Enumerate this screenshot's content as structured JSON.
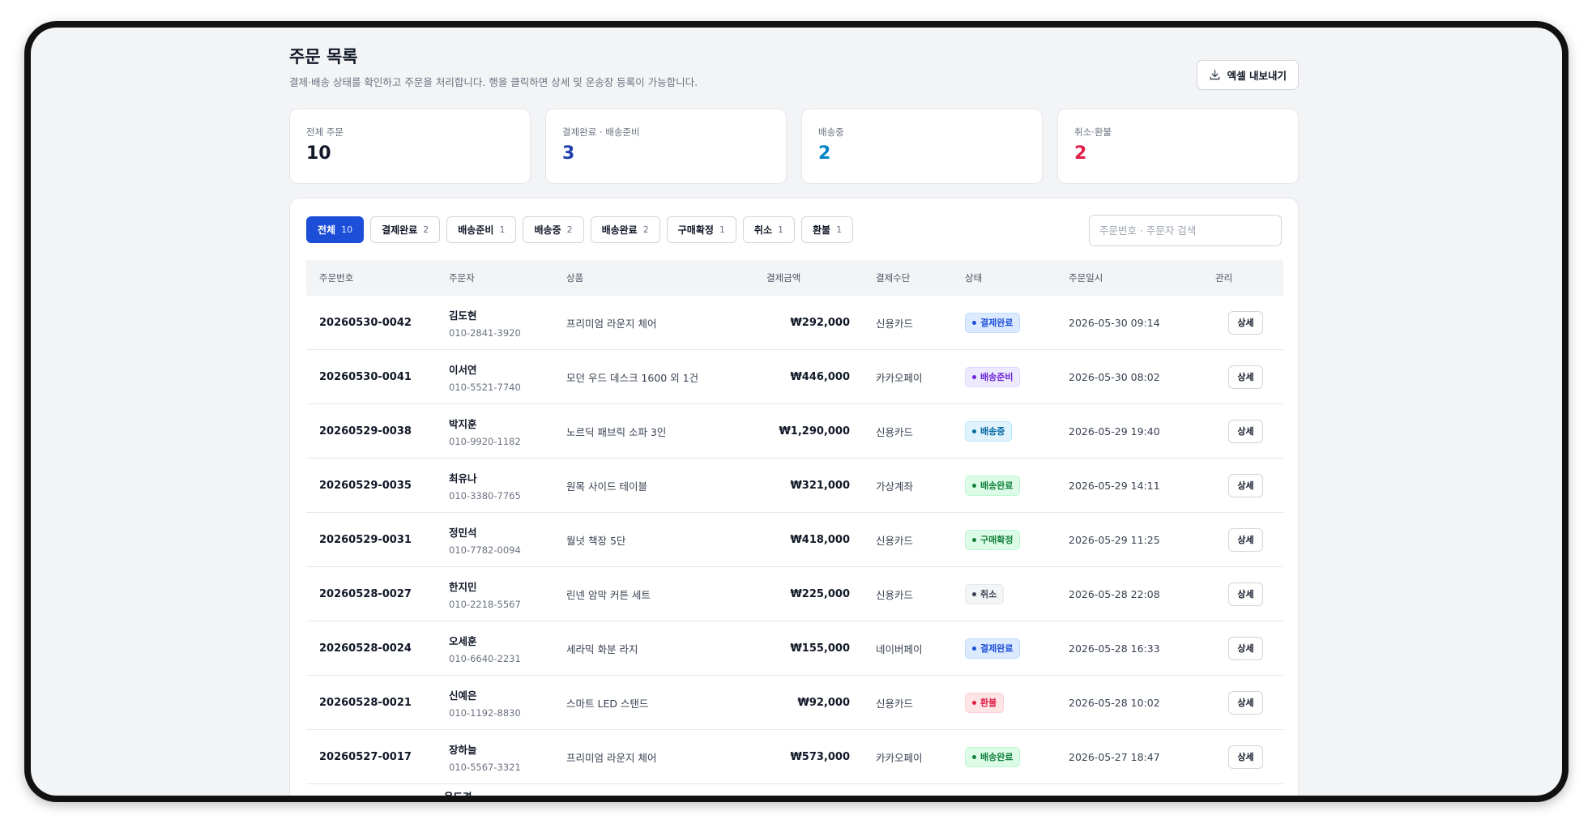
{
  "page": {
    "title": "주문 목록",
    "subtitle": "결제·배송 상태를 확인하고 주문을 처리합니다. 행을 클릭하면 상세 및 운송장 등록이 가능합니다.",
    "export_label": "엑셀 내보내기"
  },
  "stats": [
    {
      "label": "전체 주문",
      "value": "10",
      "color": "#111827"
    },
    {
      "label": "결제완료 · 배송준비",
      "value": "3",
      "color": "#1e40af"
    },
    {
      "label": "배송중",
      "value": "2",
      "color": "#0284c7"
    },
    {
      "label": "취소·환불",
      "value": "2",
      "color": "#e11d48"
    }
  ],
  "filters": [
    {
      "label": "전체",
      "count": "10",
      "active": true
    },
    {
      "label": "결제완료",
      "count": "2",
      "active": false
    },
    {
      "label": "배송준비",
      "count": "1",
      "active": false
    },
    {
      "label": "배송중",
      "count": "2",
      "active": false
    },
    {
      "label": "배송완료",
      "count": "2",
      "active": false
    },
    {
      "label": "구매확정",
      "count": "1",
      "active": false
    },
    {
      "label": "취소",
      "count": "1",
      "active": false
    },
    {
      "label": "환불",
      "count": "1",
      "active": false
    }
  ],
  "search": {
    "placeholder": "주문번호 · 주문자 검색"
  },
  "table": {
    "headers": [
      "주문번호",
      "주문자",
      "상품",
      "결제금액",
      "결제수단",
      "상태",
      "주문일시",
      "관리"
    ],
    "detail_label": "상세",
    "rows": [
      {
        "order_no": "20260530-0042",
        "name": "김도현",
        "phone": "010-2841-3920",
        "product": "프리미엄 라운지 체어",
        "amount": "₩292,000",
        "method": "신용카드",
        "status": "결제완료",
        "date": "2026-05-30 09:14"
      },
      {
        "order_no": "20260530-0041",
        "name": "이서연",
        "phone": "010-5521-7740",
        "product": "모던 우드 데스크 1600 외 1건",
        "amount": "₩446,000",
        "method": "카카오페이",
        "status": "배송준비",
        "date": "2026-05-30 08:02"
      },
      {
        "order_no": "20260529-0038",
        "name": "박지훈",
        "phone": "010-9920-1182",
        "product": "노르딕 패브릭 소파 3인",
        "amount": "₩1,290,000",
        "method": "신용카드",
        "status": "배송중",
        "date": "2026-05-29 19:40"
      },
      {
        "order_no": "20260529-0035",
        "name": "최유나",
        "phone": "010-3380-7765",
        "product": "원목 사이드 테이블",
        "amount": "₩321,000",
        "method": "가상계좌",
        "status": "배송완료",
        "date": "2026-05-29 14:11"
      },
      {
        "order_no": "20260529-0031",
        "name": "정민석",
        "phone": "010-7782-0094",
        "product": "월넛 책장 5단",
        "amount": "₩418,000",
        "method": "신용카드",
        "status": "구매확정",
        "date": "2026-05-29 11:25"
      },
      {
        "order_no": "20260528-0027",
        "name": "한지민",
        "phone": "010-2218-5567",
        "product": "린넨 암막 커튼 세트",
        "amount": "₩225,000",
        "method": "신용카드",
        "status": "취소",
        "date": "2026-05-28 22:08"
      },
      {
        "order_no": "20260528-0024",
        "name": "오세훈",
        "phone": "010-6640-2231",
        "product": "세라믹 화분 라지",
        "amount": "₩155,000",
        "method": "네이버페이",
        "status": "결제완료",
        "date": "2026-05-28 16:33"
      },
      {
        "order_no": "20260528-0021",
        "name": "신예은",
        "phone": "010-1192-8830",
        "product": "스마트 LED 스탠드",
        "amount": "₩92,000",
        "method": "신용카드",
        "status": "환불",
        "date": "2026-05-28 10:02"
      },
      {
        "order_no": "20260527-0017",
        "name": "장하늘",
        "phone": "010-5567-3321",
        "product": "프리미엄 라운지 체어",
        "amount": "₩573,000",
        "method": "카카오페이",
        "status": "배송완료",
        "date": "2026-05-27 18:47"
      }
    ],
    "partial_row_name": "윤도경"
  },
  "status_styles": {
    "결제완료": {
      "bg": "#dbeafe",
      "fg": "#1d4ed8",
      "border": "#bfdbfe"
    },
    "배송준비": {
      "bg": "#ede9fe",
      "fg": "#6d28d9",
      "border": "#ddd6fe"
    },
    "배송중": {
      "bg": "#e0f2fe",
      "fg": "#0369a1",
      "border": "#bae6fd"
    },
    "배송완료": {
      "bg": "#dcfce7",
      "fg": "#15803d",
      "border": "#bbf7d0"
    },
    "구매확정": {
      "bg": "#dcfce7",
      "fg": "#15803d",
      "border": "#bbf7d0"
    },
    "취소": {
      "bg": "#f3f4f6",
      "fg": "#374151",
      "border": "#e5e7eb"
    },
    "환불": {
      "bg": "#ffe4e6",
      "fg": "#e11d48",
      "border": "#fecdd3"
    }
  },
  "icons": {
    "export": "download-icon",
    "status": "status-dot-icon"
  }
}
